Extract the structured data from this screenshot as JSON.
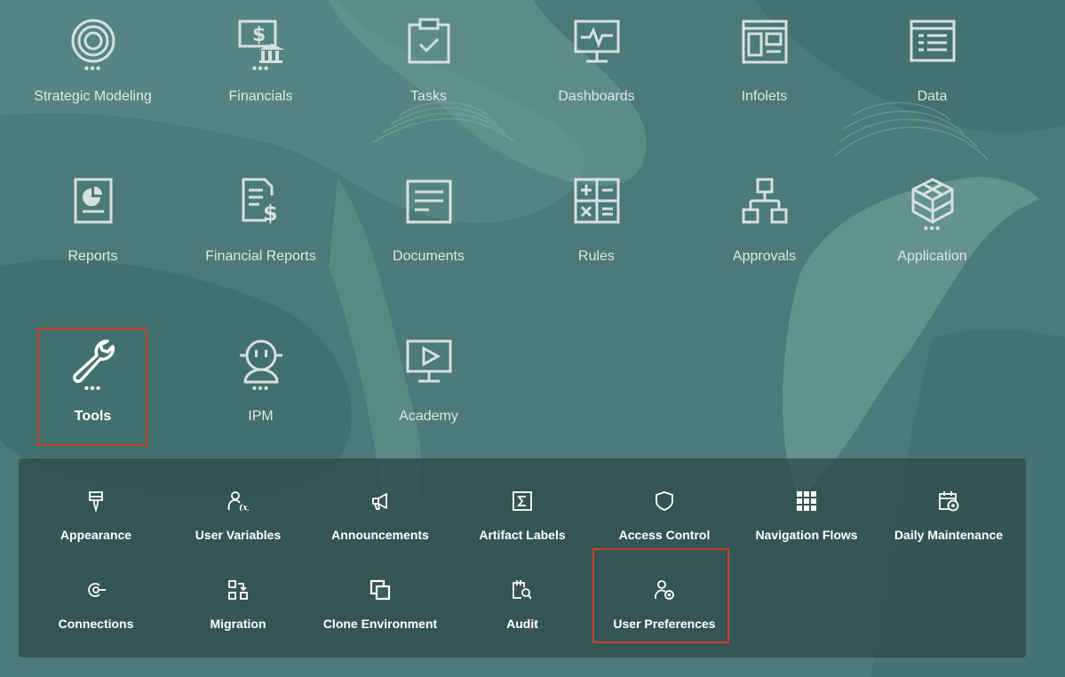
{
  "home_tiles": [
    {
      "label": "Strategic Modeling",
      "icon": "target-icon",
      "has_more": true
    },
    {
      "label": "Financials",
      "icon": "finance-bank-icon",
      "has_more": true
    },
    {
      "label": "Tasks",
      "icon": "clipboard-check-icon",
      "has_more": false
    },
    {
      "label": "Dashboards",
      "icon": "monitor-pulse-icon",
      "has_more": false
    },
    {
      "label": "Infolets",
      "icon": "infolet-layout-icon",
      "has_more": false
    },
    {
      "label": "Data",
      "icon": "data-grid-icon",
      "has_more": false
    },
    {
      "label": "Reports",
      "icon": "report-chart-icon",
      "has_more": false
    },
    {
      "label": "Financial Reports",
      "icon": "document-dollar-icon",
      "has_more": false
    },
    {
      "label": "Documents",
      "icon": "document-lines-icon",
      "has_more": false
    },
    {
      "label": "Rules",
      "icon": "calculator-icon",
      "has_more": false
    },
    {
      "label": "Approvals",
      "icon": "hierarchy-icon",
      "has_more": false
    },
    {
      "label": "Application",
      "icon": "cube-icon",
      "has_more": true
    },
    {
      "label": "Tools",
      "icon": "wrench-icon",
      "has_more": true,
      "active": true
    },
    {
      "label": "IPM",
      "icon": "robot-icon",
      "has_more": true
    },
    {
      "label": "Academy",
      "icon": "video-play-icon",
      "has_more": false
    }
  ],
  "more_indicator": "•••",
  "tools_menu": [
    {
      "label": "Appearance",
      "icon": "paint-brush-icon"
    },
    {
      "label": "User Variables",
      "icon": "user-variable-icon"
    },
    {
      "label": "Announcements",
      "icon": "megaphone-icon"
    },
    {
      "label": "Artifact Labels",
      "icon": "sigma-icon"
    },
    {
      "label": "Access Control",
      "icon": "shield-icon"
    },
    {
      "label": "Navigation Flows",
      "icon": "grid-flow-icon"
    },
    {
      "label": "Daily Maintenance",
      "icon": "calendar-gear-icon"
    },
    {
      "label": "Connections",
      "icon": "connection-icon"
    },
    {
      "label": "Migration",
      "icon": "migration-icon"
    },
    {
      "label": "Clone Environment",
      "icon": "clone-icon"
    },
    {
      "label": "Audit",
      "icon": "audit-search-icon"
    },
    {
      "label": "User Preferences",
      "icon": "user-gear-icon",
      "highlighted": true
    }
  ],
  "colors": {
    "background": "#4b7a78",
    "panel": "#304a4c",
    "highlight": "#c9402b",
    "icon": "#d6e0df"
  }
}
